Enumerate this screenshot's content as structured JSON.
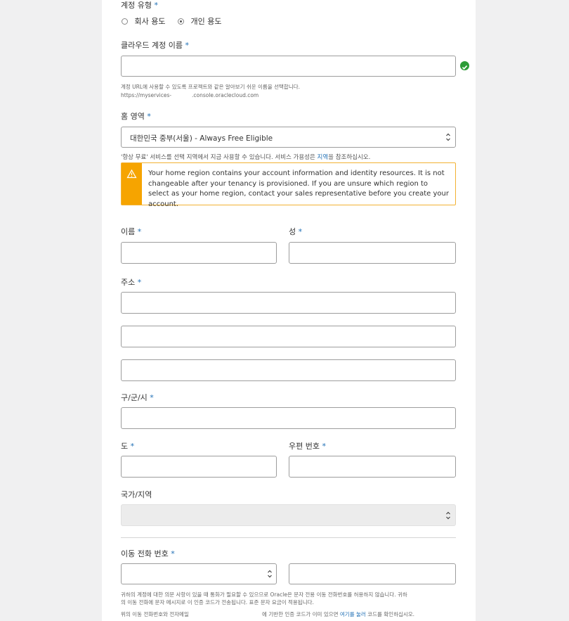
{
  "account_type": {
    "label": "계정 유형",
    "required_mark": "*",
    "options": [
      "회사 용도",
      "개인 용도"
    ],
    "selected": "개인 용도"
  },
  "cloud_account_name": {
    "label": "클라우드 계정 이름",
    "required_mark": "*",
    "value": "",
    "valid_icon": "check-circle-icon",
    "help_line1": "계정 URL에 사용할 수 있도록 프로젝트와 같은 알아보기 쉬운 이름을 선택합니다.",
    "help_url_prefix": "https://myservices-",
    "help_url_suffix": ".console.oraclecloud.com"
  },
  "home_region": {
    "label": "홈 영역",
    "required_mark": "*",
    "selected": "대한민국 중부(서울) - Always Free Eligible",
    "note_before_link": "'항상 무료' 서비스를 선택 지역에서 지금 사용할 수 있습니다. 서비스 가용성은 ",
    "note_link": "지역",
    "note_after_link": "을 참조하십시오."
  },
  "warning": {
    "icon": "warning-triangle-icon",
    "text": "Your home region contains your account information and identity resources. It is not changeable after your tenancy is provisioned. If you are unsure which region to select as your home region, contact your sales representative before you create your account."
  },
  "first_name": {
    "label": "이름",
    "required_mark": "*",
    "value": ""
  },
  "last_name": {
    "label": "성",
    "required_mark": "*",
    "value": ""
  },
  "address": {
    "label": "주소",
    "required_mark": "*",
    "line1": "",
    "line2": "",
    "line3": ""
  },
  "city": {
    "label": "구/군/시",
    "required_mark": "*",
    "value": ""
  },
  "province": {
    "label": "도",
    "required_mark": "*",
    "value": ""
  },
  "postal_code": {
    "label": "우편 번호",
    "required_mark": "*",
    "value": ""
  },
  "country": {
    "label": "국가/지역",
    "selected": ""
  },
  "mobile_phone": {
    "label": "이동 전화 번호",
    "required_mark": "*",
    "country_code": "",
    "number": "",
    "help_line1": "귀하의 계정에 대한 의문 사항이 있을 때 통화가 필요할 수 있으므로 Oracle은 문자 전용 이동 전화번호를 허용하지 않습니다. 귀하",
    "help_line2": "의 이동 전화에 문자 메시지로 이 인증 코드가 전송됩니다. 표준 문자 요금이 적용됩니다.",
    "verify_left": "위의 이동 전화번호와 전자메일",
    "verify_mid": "에 기반한 인증 코드가 이미 있으면 ",
    "verify_link": "여기를 눌러",
    "verify_right": " 코드를 확인하십시오."
  },
  "colors": {
    "accent": "#1f6fb5",
    "warning": "#f6a400",
    "valid": "#2c9c37",
    "page_bg": "#f0f0f1"
  }
}
